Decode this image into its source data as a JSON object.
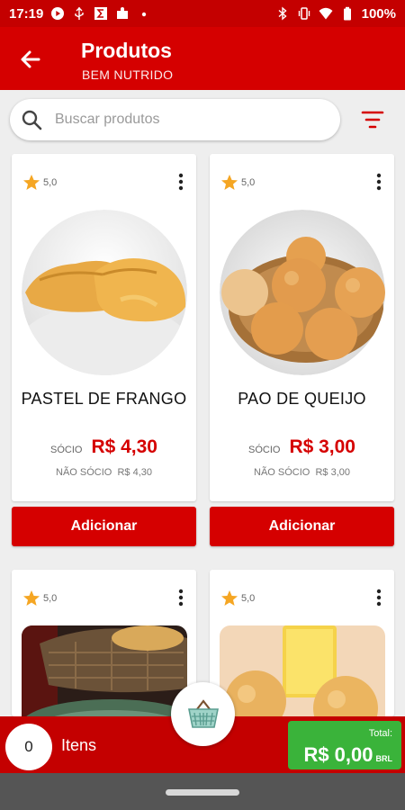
{
  "status_bar": {
    "time": "17:19",
    "battery": "100%",
    "notification_icons": [
      "youtube-icon",
      "usb-icon",
      "sigma-icon",
      "puzzle-icon",
      "dot-icon"
    ],
    "system_icons": [
      "bluetooth-icon",
      "vibrate-icon",
      "wifi-icon",
      "battery-icon"
    ]
  },
  "header": {
    "title": "Produtos",
    "subtitle": "BEM NUTRIDO",
    "back_icon": "arrow-left-icon"
  },
  "search": {
    "placeholder": "Buscar produtos",
    "value": "",
    "filter_icon": "filter-icon"
  },
  "products": [
    {
      "rating": "5,0",
      "name": "PASTEL DE FRANGO",
      "member_label": "SÓCIO",
      "member_price": "R$ 4,30",
      "nonmember_label": "NÃO SÓCIO",
      "nonmember_price": "R$ 4,30",
      "button_label": "Adicionar"
    },
    {
      "rating": "5,0",
      "name": "PAO DE QUEIJO",
      "member_label": "SÓCIO",
      "member_price": "R$ 3,00",
      "nonmember_label": "NÃO SÓCIO",
      "nonmember_price": "R$ 3,00",
      "button_label": "Adicionar"
    },
    {
      "rating": "5,0"
    },
    {
      "rating": "5,0"
    }
  ],
  "cart": {
    "count": "0",
    "items_label": "Itens",
    "total_label": "Total:",
    "total_value": "R$ 0,00",
    "currency": "BRL",
    "basket_icon": "basket-icon"
  },
  "colors": {
    "primary": "#d50000",
    "status_bar": "#c40000",
    "total_green": "#3ab33a",
    "star": "#f5a623"
  }
}
